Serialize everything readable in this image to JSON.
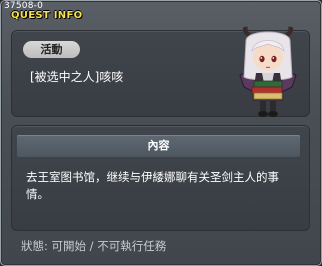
{
  "header": {
    "id_label": "37508-0",
    "title": "QUEST INFO"
  },
  "quest": {
    "tag": "活動",
    "name": "[被选中之人]咳咳"
  },
  "content": {
    "header": "內容",
    "text": "去王室图书馆，继续与伊緌娜聊有关圣剑主人的事情。"
  },
  "status": {
    "text": "狀態: 可開始 / 不可執行任務"
  },
  "icons": {
    "portrait": "npc-portrait-icon"
  }
}
